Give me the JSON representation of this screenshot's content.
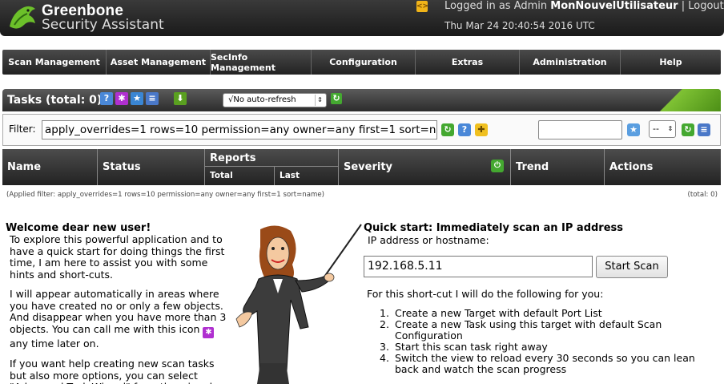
{
  "header": {
    "brand_line1": "Greenbone",
    "brand_line2": "Security Assistant",
    "logged_prefix": "Logged in as Admin",
    "username": "MonNouvelUtilisateur",
    "separator": "|",
    "logout": "Logout",
    "datetime": "Thu Mar 24 20:40:54 2016 UTC",
    "lang_icon": "<>"
  },
  "nav": {
    "items": [
      "Scan Management",
      "Asset Management",
      "SecInfo Management",
      "Configuration",
      "Extras",
      "Administration",
      "Help"
    ]
  },
  "tasks": {
    "title": "Tasks (total: 0)",
    "refresh_option": "√No auto-refresh",
    "icons": [
      "help-icon",
      "wizard-icon",
      "new-task-icon",
      "list-icon",
      "export-icon",
      "refresh-icon"
    ]
  },
  "filter": {
    "label": "Filter:",
    "value": "apply_overrides=1 rows=10 permission=any owner=any first=1 sort=name",
    "name_value": "",
    "select_value": "--"
  },
  "table": {
    "headers": {
      "name": "Name",
      "status": "Status",
      "reports": "Reports",
      "reports_total": "Total",
      "reports_last": "Last",
      "severity": "Severity",
      "trend": "Trend",
      "actions": "Actions"
    },
    "applied_filter": "(Applied filter: apply_overrides=1 rows=10 permission=any owner=any first=1 sort=name)",
    "total": "(total: 0)"
  },
  "welcome": {
    "title": "Welcome dear new user!",
    "p1": "To explore this powerful application and to have a quick start for doing things the first time, I am here to assist you with some hints and short-cuts.",
    "p2": "I will appear automatically in areas where you have created no or only a few objects. And disappear when you have more than 3 objects. You can call me with this icon",
    "p2_end": "any time later on.",
    "p3": "If you want help creating new scan tasks but also more options, you can select \"Advanced Task Wizard\" from the wizard"
  },
  "quickstart": {
    "title": "Quick start: Immediately scan an IP address",
    "label": "IP address or hostname:",
    "ip_value": "192.168.5.11",
    "button": "Start Scan",
    "desc": "For this short-cut I will do the following for you:",
    "steps": [
      "Create a new Target with default Port List",
      "Create a new Task using this target with default Scan Configuration",
      "Start this scan task right away",
      "Switch the view to reload every 30 seconds so you can lean back and watch the scan progress"
    ]
  },
  "colors": {
    "accent_green": "#64b41e",
    "header_dark": "#2a2a2a",
    "wizard_purple": "#b030d0",
    "help_blue": "#4a88d8"
  }
}
